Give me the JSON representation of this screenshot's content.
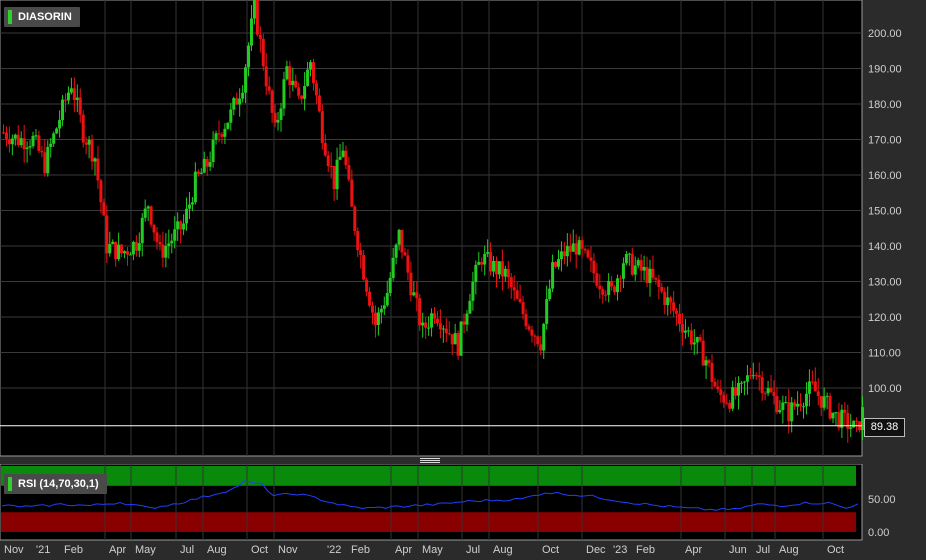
{
  "title": "DIASORIN",
  "rsi_label": "RSI (14,70,30,1)",
  "last_price_label": "89.38",
  "colors": {
    "up": "#22cc22",
    "down": "#ee1111",
    "rsi_line": "#1f3fff",
    "overbought": "#0a8a0a",
    "oversold": "#8a0000"
  },
  "chart_data": [
    {
      "type": "candlestick",
      "x_tick_labels": [
        "Nov",
        "'21",
        "Feb",
        "Apr",
        "May",
        "Jul",
        "Aug",
        "Oct",
        "Nov",
        "'22",
        "Feb",
        "Apr",
        "May",
        "Jul",
        "Aug",
        "Oct",
        "Dec",
        "'23",
        "Feb",
        "Apr",
        "Jun",
        "Jul",
        "Aug",
        "Oct"
      ],
      "y_tick_labels": [
        "100.00",
        "110.00",
        "120.00",
        "130.00",
        "140.00",
        "150.00",
        "160.00",
        "170.00",
        "180.00",
        "190.00",
        "200.00"
      ],
      "ylim": [
        82,
        210
      ],
      "grid": true,
      "last_price": 89.38,
      "anchors": [
        [
          0,
          172
        ],
        [
          5,
          170
        ],
        [
          10,
          170
        ],
        [
          14,
          163
        ],
        [
          19,
          176
        ],
        [
          23,
          186
        ],
        [
          27,
          172
        ],
        [
          31,
          165
        ],
        [
          35,
          140
        ],
        [
          40,
          138
        ],
        [
          45,
          141
        ],
        [
          49,
          152
        ],
        [
          53,
          138
        ],
        [
          57,
          142
        ],
        [
          61,
          146
        ],
        [
          65,
          158
        ],
        [
          69,
          163
        ],
        [
          73,
          172
        ],
        [
          77,
          177
        ],
        [
          81,
          186
        ],
        [
          85,
          207
        ],
        [
          88,
          192
        ],
        [
          92,
          172
        ],
        [
          96,
          190
        ],
        [
          100,
          180
        ],
        [
          104,
          192
        ],
        [
          108,
          172
        ],
        [
          112,
          158
        ],
        [
          115,
          168
        ],
        [
          118,
          150
        ],
        [
          122,
          133
        ],
        [
          126,
          118
        ],
        [
          130,
          127
        ],
        [
          134,
          143
        ],
        [
          138,
          129
        ],
        [
          142,
          116
        ],
        [
          146,
          122
        ],
        [
          150,
          117
        ],
        [
          154,
          112
        ],
        [
          158,
          127
        ],
        [
          162,
          137
        ],
        [
          166,
          134
        ],
        [
          170,
          132
        ],
        [
          174,
          124
        ],
        [
          178,
          118
        ],
        [
          182,
          113
        ],
        [
          186,
          133
        ],
        [
          190,
          138
        ],
        [
          194,
          140
        ],
        [
          198,
          135
        ],
        [
          202,
          130
        ],
        [
          206,
          127
        ],
        [
          210,
          136
        ],
        [
          214,
          134
        ],
        [
          218,
          132
        ],
        [
          222,
          128
        ],
        [
          226,
          123
        ],
        [
          230,
          118
        ],
        [
          234,
          113
        ],
        [
          238,
          108
        ],
        [
          242,
          98
        ],
        [
          246,
          97
        ],
        [
          250,
          99
        ],
        [
          254,
          106
        ],
        [
          258,
          100
        ],
        [
          262,
          96
        ],
        [
          266,
          93
        ],
        [
          270,
          97
        ],
        [
          274,
          100
        ],
        [
          278,
          96
        ],
        [
          282,
          92
        ],
        [
          286,
          90
        ],
        [
          289,
          88
        ],
        [
          291,
          93
        ]
      ]
    },
    {
      "type": "line",
      "name": "RSI (14,70,30,1)",
      "y_tick_labels": [
        "50.00",
        "0.00"
      ],
      "ylim": [
        0,
        100
      ],
      "overbought": 70,
      "oversold": 30,
      "anchors": [
        [
          0,
          40
        ],
        [
          10,
          38
        ],
        [
          20,
          42
        ],
        [
          30,
          40
        ],
        [
          40,
          45
        ],
        [
          50,
          36
        ],
        [
          60,
          44
        ],
        [
          70,
          55
        ],
        [
          78,
          65
        ],
        [
          82,
          76
        ],
        [
          88,
          72
        ],
        [
          92,
          55
        ],
        [
          100,
          58
        ],
        [
          106,
          52
        ],
        [
          112,
          44
        ],
        [
          118,
          38
        ],
        [
          124,
          36
        ],
        [
          132,
          38
        ],
        [
          140,
          40
        ],
        [
          148,
          42
        ],
        [
          156,
          46
        ],
        [
          166,
          48
        ],
        [
          176,
          50
        ],
        [
          184,
          60
        ],
        [
          190,
          58
        ],
        [
          200,
          54
        ],
        [
          212,
          45
        ],
        [
          222,
          40
        ],
        [
          232,
          36
        ],
        [
          240,
          34
        ],
        [
          248,
          34
        ],
        [
          256,
          42
        ],
        [
          264,
          40
        ],
        [
          272,
          44
        ],
        [
          280,
          44
        ],
        [
          286,
          36
        ],
        [
          291,
          46
        ]
      ]
    }
  ]
}
